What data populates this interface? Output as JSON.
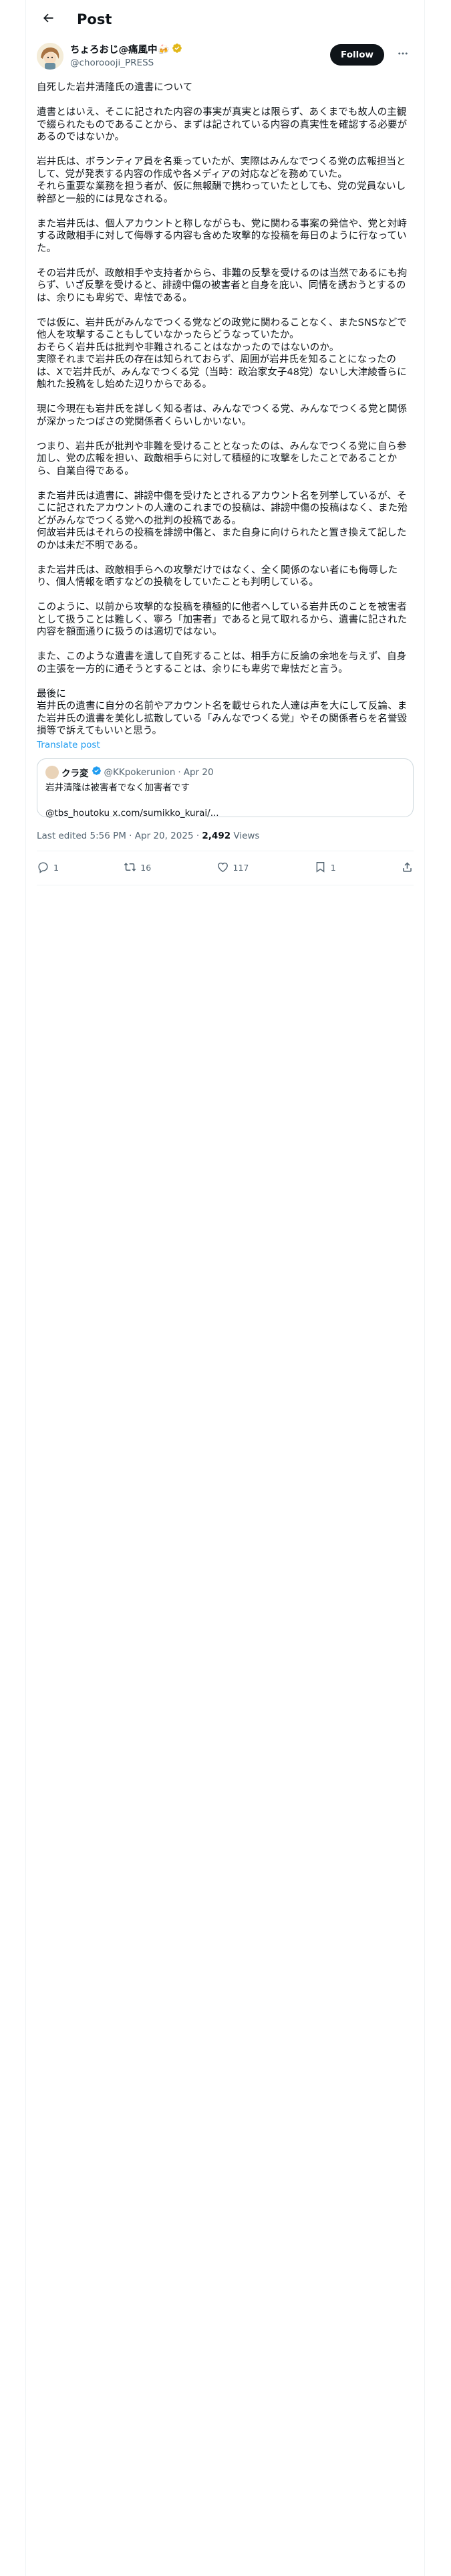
{
  "header": {
    "title": "Post"
  },
  "author": {
    "display_name": "ちょろおじ@痛風中🍻",
    "handle": "@choroooji_PRESS",
    "verified": true
  },
  "follow_label": "Follow",
  "post": {
    "paragraphs": [
      "自死した岩井清隆氏の遺書について",
      "遺書とはいえ、そこに記された内容の事実が真実とは限らず、あくまでも故人の主観で綴られたものであることから、まずは記されている内容の真実性を確認する必要があるのではないか。",
      "岩井氏は、ボランティア員を名乗っていたが、実際はみんなでつくる党の広報担当として、党が発表する内容の作成や各メディアの対応などを務めていた。\nそれら重要な業務を担う者が、仮に無報酬で携わっていたとしても、党の党員ないし幹部と一般的には見なされる。",
      "また岩井氏は、個人アカウントと称しながらも、党に関わる事案の発信や、党と対峙する政敵相手に対して侮辱する内容も含めた攻撃的な投稿を毎日のように行なっていた。",
      "その岩井氏が、政敵相手や支持者からら、非難の反撃を受けるのは当然であるにも拘らず、いざ反撃を受けると、誹謗中傷の被害者と自身を庇い、同情を誘おうとするのは、余りにも卑劣で、卑怯である。",
      "では仮に、岩井氏がみんなでつくる党などの政党に関わることなく、またSNSなどで他人を攻撃することもしていなかったらどうなっていたか。\nおそらく岩井氏は批判や非難されることはなかったのではないのか。\n実際それまで岩井氏の存在は知られておらず、周囲が岩井氏を知ることになったのは、Xで岩井氏が、みんなでつくる党（当時：政治家女子48党）ないし大津綾香らに触れた投稿をし始めた辺りからである。",
      "現に今現在も岩井氏を詳しく知る者は、みんなでつくる党、みんなでつくる党と関係が深かったつばさの党関係者くらいしかいない。",
      "つまり、岩井氏が批判や非難を受けることとなったのは、みんなでつくる党に自ら参加し、党の広報を担い、政敵相手らに対して積極的に攻撃をしたことであることから、自業自得である。",
      "また岩井氏は遺書に、誹謗中傷を受けたとされるアカウント名を列挙しているが、そこに記されたアカウントの人達のこれまでの投稿は、誹謗中傷の投稿はなく、また殆どがみんなでつくる党への批判の投稿である。\n何故岩井氏はそれらの投稿を誹謗中傷と、また自身に向けられたと置き換えて記したのかは未だ不明である。",
      "また岩井氏は、政敵相手らへの攻撃だけではなく、全く関係のない者にも侮辱したり、個人情報を晒すなどの投稿をしていたことも判明している。",
      "このように、以前から攻撃的な投稿を積極的に他者へしている岩井氏のことを被害者として扱うことは難しく、寧ろ「加害者」であると見て取れるから、遺書に記された内容を額面通りに扱うのは適切ではない。",
      "また、このような遺書を遺して自死することは、相手方に反論の余地を与えず、自身の主張を一方的に通そうとすることは、余りにも卑劣で卑怯だと言う。",
      "最後に\n岩井氏の遺書に自分の名前やアカウント名を載せられた人達は声を大にして反論、また岩井氏の遺書を美化し拡散している「みんなでつくる党」やその関係者らを名誉毀損等で訴えてもいいと思う。"
    ]
  },
  "translate_label": "Translate post",
  "quote": {
    "name": "クラ変",
    "verified": true,
    "handle": "@KKpokerunion",
    "separator": "·",
    "date": "Apr 20",
    "text": "岩井清隆は被害者でなく加害者です\n\n@tbs_houtoku x.com/sumikko_kurai/..."
  },
  "meta": {
    "edited_label": "Last edited 5:56 PM · Apr 20, 2025 · ",
    "views_count": "2,492",
    "views_label": " Views"
  },
  "actions": {
    "reply_count": "1",
    "repost_count": "16",
    "like_count": "117",
    "bookmark_count": "1"
  },
  "colors": {
    "accent": "#1d9bf0",
    "text": "#0f1419",
    "muted": "#536471",
    "border": "#eff3f4",
    "verified_gold": "#e2b719"
  }
}
